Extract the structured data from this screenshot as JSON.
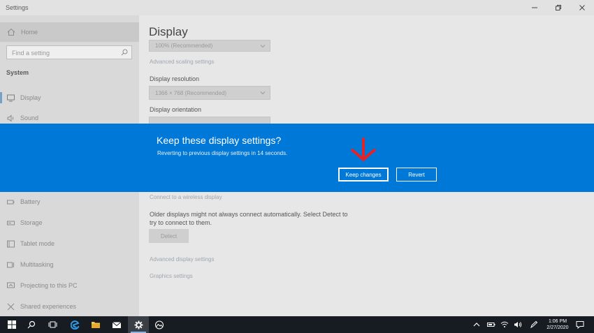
{
  "window": {
    "title": "Settings"
  },
  "sidebar": {
    "home_label": "Home",
    "search_placeholder": "Find a setting",
    "section_title": "System",
    "items": [
      {
        "label": "Display",
        "icon": "monitor-icon",
        "selected": true
      },
      {
        "label": "Sound",
        "icon": "speaker-icon"
      },
      {
        "label": "Battery",
        "icon": "battery-icon"
      },
      {
        "label": "Storage",
        "icon": "storage-icon"
      },
      {
        "label": "Tablet mode",
        "icon": "tablet-icon"
      },
      {
        "label": "Multitasking",
        "icon": "multitasking-icon"
      },
      {
        "label": "Projecting to this PC",
        "icon": "projecting-icon"
      },
      {
        "label": "Shared experiences",
        "icon": "shared-icon"
      }
    ]
  },
  "main": {
    "title": "Display",
    "scale_value": "100% (Recommended)",
    "advanced_scaling_link": "Advanced scaling settings",
    "resolution_label": "Display resolution",
    "resolution_value": "1366 × 768 (Recommended)",
    "orientation_label": "Display orientation",
    "wireless_link": "Connect to a wireless display",
    "detect_text_line1": "Older displays might not always connect automatically. Select Detect to",
    "detect_text_line2": "try to connect to them.",
    "detect_button": "Detect",
    "advanced_display_link": "Advanced display settings",
    "graphics_link": "Graphics settings"
  },
  "dialog": {
    "title": "Keep these display settings?",
    "message": "Reverting to previous display settings in 14 seconds.",
    "keep_button": "Keep changes",
    "revert_button": "Revert",
    "accent_color": "#0078d7",
    "annotation_arrow_color": "#e0242a"
  },
  "taskbar": {
    "time": "1:06 PM",
    "date": "2/27/2020"
  }
}
